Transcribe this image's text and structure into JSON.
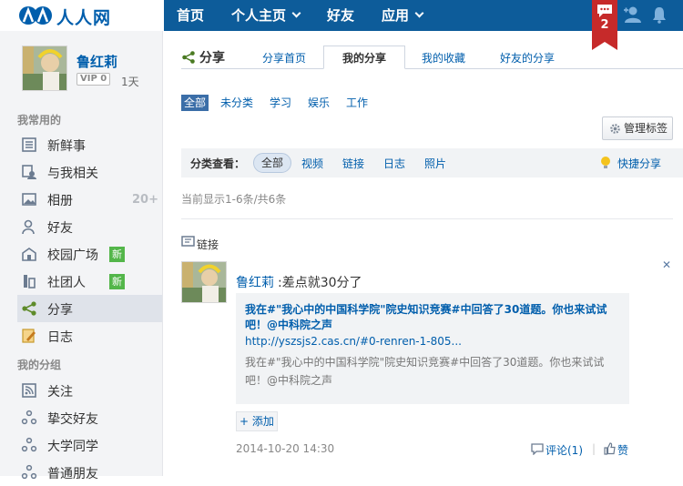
{
  "topbar": {
    "logo_text": "人人网",
    "nav": [
      {
        "label": "首页"
      },
      {
        "label": "个人主页"
      },
      {
        "label": "好友"
      },
      {
        "label": "应用"
      }
    ],
    "message_count": "2"
  },
  "sidebar": {
    "user_name": "鲁红莉",
    "vip_label": "VIP 0",
    "vip_days": "1天",
    "common_heading": "我常用的",
    "common_items": [
      {
        "label": "新鲜事"
      },
      {
        "label": "与我相关"
      },
      {
        "label": "相册",
        "count": "20+"
      },
      {
        "label": "好友"
      },
      {
        "label": "校园广场",
        "tag": "新"
      },
      {
        "label": "社团人",
        "tag": "新"
      },
      {
        "label": "分享"
      },
      {
        "label": "日志"
      }
    ],
    "groups_heading": "我的分组",
    "group_items": [
      {
        "label": "关注"
      },
      {
        "label": "挚交好友"
      },
      {
        "label": "大学同学"
      },
      {
        "label": "普通朋友"
      }
    ]
  },
  "main": {
    "title": "分享",
    "tabs": [
      {
        "label": "分享首页"
      },
      {
        "label": "我的分享"
      },
      {
        "label": "我的收藏"
      },
      {
        "label": "好友的分享"
      }
    ],
    "categories": [
      {
        "label": "全部"
      },
      {
        "label": "未分类"
      },
      {
        "label": "学习"
      },
      {
        "label": "娱乐"
      },
      {
        "label": "工作"
      }
    ],
    "manage_label": "管理标签",
    "filter": {
      "label": "分类查看：",
      "options": [
        {
          "label": "全部"
        },
        {
          "label": "视频"
        },
        {
          "label": "链接"
        },
        {
          "label": "日志"
        },
        {
          "label": "照片"
        }
      ],
      "quick_share": "快捷分享"
    },
    "showing": "当前显示1-6条/共6条",
    "post": {
      "type_label": "链接",
      "user": "鲁红莉",
      "text": ":差点就30分了",
      "link_title": "我在#\"我心中的中国科学院\"院史知识竞赛#中回答了30道题。你也来试试吧！@中科院之声",
      "link_url": "http://yszsjs2.cas.cn/#0-renren-1-805...",
      "link_desc": "我在#\"我心中的中国科学院\"院史知识竞赛#中回答了30道题。你也来试试吧！@中科院之声",
      "add_tag": "+ 添加",
      "time": "2014-10-20 14:30",
      "comment": "评论(1)",
      "sep": "|",
      "like": "赞"
    }
  },
  "colors": {
    "topbar": "#0d5c9a",
    "link": "#005eac",
    "badge": "#c62a2a",
    "new_tag": "#53b64a"
  }
}
